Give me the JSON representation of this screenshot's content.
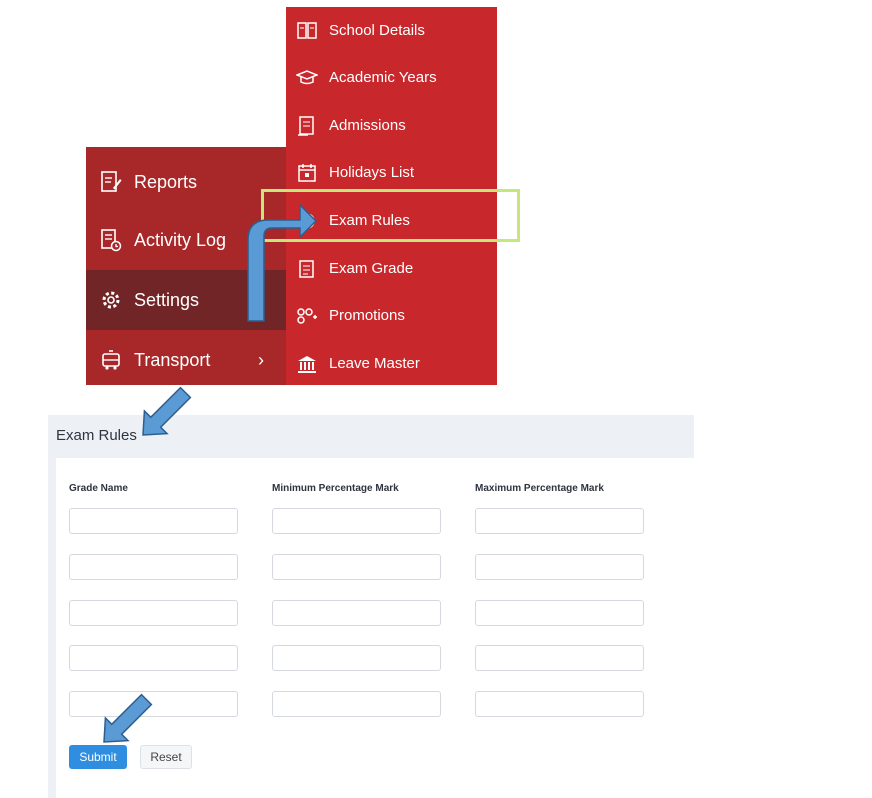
{
  "main_menu": {
    "items": [
      {
        "label": "Reports",
        "icon": "report-edit-icon"
      },
      {
        "label": "Activity Log",
        "icon": "activity-log-icon"
      },
      {
        "label": "Settings",
        "icon": "gear-icon"
      },
      {
        "label": "Transport",
        "icon": "bus-icon",
        "chevron": "›"
      }
    ]
  },
  "sub_menu": {
    "items": [
      {
        "label": "School Details",
        "icon": "school-icon"
      },
      {
        "label": "Academic Years",
        "icon": "graduation-cap-icon"
      },
      {
        "label": "Admissions",
        "icon": "admission-form-icon"
      },
      {
        "label": "Holidays List",
        "icon": "calendar-icon"
      },
      {
        "label": "Exam Rules",
        "icon": "exam-rules-icon"
      },
      {
        "label": "Exam Grade",
        "icon": "exam-grade-icon"
      },
      {
        "label": "Promotions",
        "icon": "people-icon"
      },
      {
        "label": "Leave Master",
        "icon": "bank-building-icon"
      }
    ]
  },
  "exam_rules": {
    "title": "Exam Rules",
    "columns": [
      "Grade Name",
      "Minimum Percentage Mark",
      "Maximum Percentage Mark"
    ],
    "rows": [
      [
        "",
        "",
        ""
      ],
      [
        "",
        "",
        ""
      ],
      [
        "",
        "",
        ""
      ],
      [
        "",
        "",
        ""
      ],
      [
        "",
        "",
        ""
      ]
    ],
    "submit_label": "Submit",
    "reset_label": "Reset"
  },
  "colors": {
    "main_menu_bg": "#a8282a",
    "main_menu_active": "#722527",
    "sub_menu_bg": "#c8282c",
    "highlight_border": "#c6e77c",
    "arrow_fill": "#5b9bd5",
    "arrow_stroke": "#2e5d8c",
    "submit_bg": "#2f8ee0"
  }
}
